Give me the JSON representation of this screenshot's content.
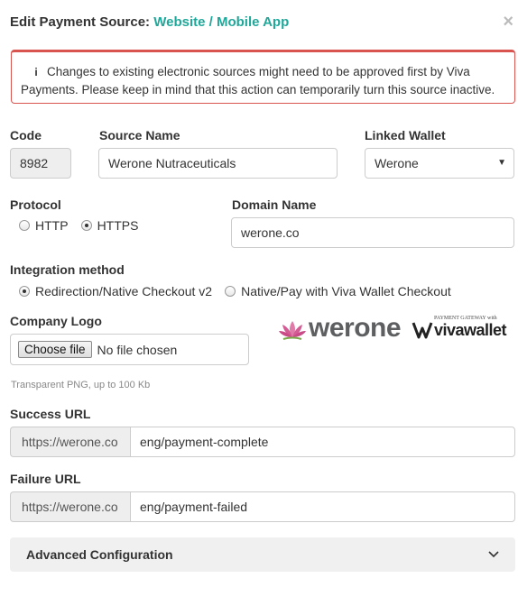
{
  "header": {
    "title_prefix": "Edit Payment Source:",
    "title_accent": "Website / Mobile App",
    "close_glyph": "×"
  },
  "alert": {
    "icon": "info-icon",
    "icon_glyph": "i",
    "text": "Changes to existing electronic sources might need to be approved first by Viva Payments. Please keep in mind that this action can temporarily turn this source inactive."
  },
  "fields": {
    "code": {
      "label": "Code",
      "value": "8982"
    },
    "source_name": {
      "label": "Source Name",
      "value": "Werone Nutraceuticals"
    },
    "linked_wallet": {
      "label": "Linked Wallet",
      "value": "Werone",
      "caret": "▼"
    },
    "protocol": {
      "label": "Protocol",
      "options": [
        "HTTP",
        "HTTPS"
      ],
      "selected": "HTTPS"
    },
    "domain_name": {
      "label": "Domain Name",
      "value": "werone.co"
    },
    "integration_method": {
      "label": "Integration method",
      "options": [
        "Redirection/Native Checkout v2",
        "Native/Pay with Viva Wallet Checkout"
      ],
      "selected": "Redirection/Native Checkout v2"
    },
    "company_logo": {
      "label": "Company Logo",
      "button": "Choose file",
      "status": "No file chosen",
      "help": "Transparent PNG, up to 100 Kb"
    },
    "success_url": {
      "label": "Success URL",
      "prefix": "https://werone.co",
      "value": "eng/payment-complete"
    },
    "failure_url": {
      "label": "Failure URL",
      "prefix": "https://werone.co",
      "value": "eng/payment-failed"
    }
  },
  "logos": {
    "werone": "werone",
    "viva_tagline": "PAYMENT GATEWAY with",
    "viva_text": "vivawallet"
  },
  "advanced": {
    "label": "Advanced Configuration",
    "chevron": "⌄"
  },
  "colors": {
    "accent": "#1fa89a",
    "alert_border": "#d9534f"
  }
}
